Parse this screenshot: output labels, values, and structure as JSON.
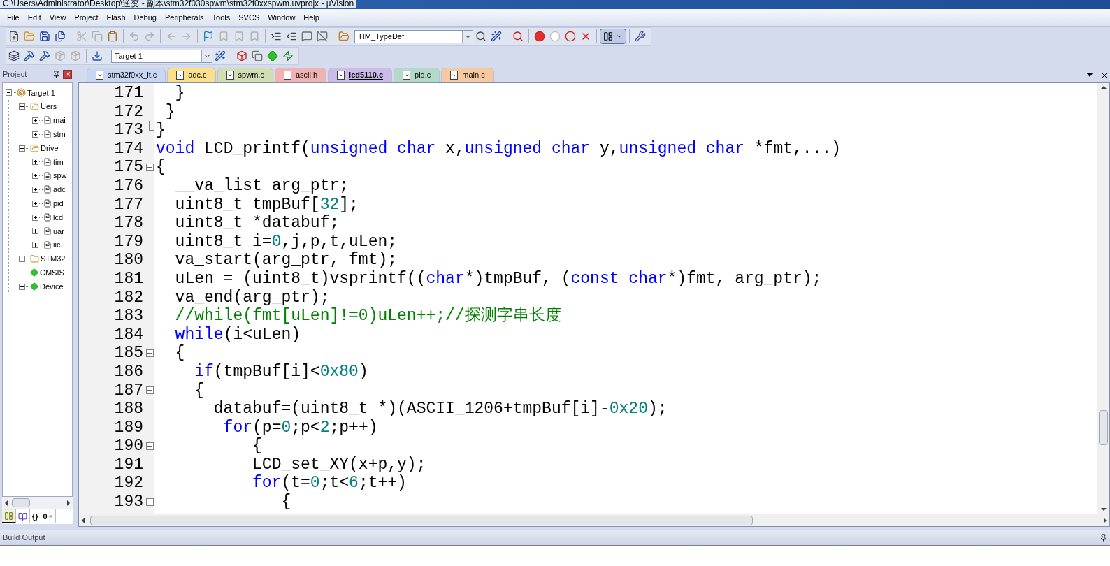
{
  "window": {
    "title": "C:\\Users\\Administrator\\Desktop\\逆变 - 副本\\stm32f030spwm\\stm32f0xxspwm.uvprojx - µVision"
  },
  "menu": [
    "File",
    "Edit",
    "View",
    "Project",
    "Flash",
    "Debug",
    "Peripherals",
    "Tools",
    "SVCS",
    "Window",
    "Help"
  ],
  "toolbar": {
    "symbol_combo": "TIM_TypeDef",
    "target_combo": "Target 1"
  },
  "project_panel": {
    "title": "Project",
    "tree": [
      {
        "label": "Target 1",
        "kind": "target",
        "expanded": true,
        "children": [
          {
            "label": "Uers",
            "kind": "folder",
            "expanded": true,
            "children": [
              {
                "label": "mai",
                "kind": "file",
                "expanded": false
              },
              {
                "label": "stm",
                "kind": "file",
                "expanded": false
              }
            ]
          },
          {
            "label": "Drive",
            "kind": "folder",
            "expanded": true,
            "children": [
              {
                "label": "tim",
                "kind": "file",
                "expanded": false
              },
              {
                "label": "spw",
                "kind": "file",
                "expanded": false
              },
              {
                "label": "adc",
                "kind": "file",
                "expanded": false
              },
              {
                "label": "pid",
                "kind": "file",
                "expanded": false
              },
              {
                "label": "lcd",
                "kind": "file",
                "expanded": false
              },
              {
                "label": "uar",
                "kind": "file",
                "expanded": false
              },
              {
                "label": "iic.",
                "kind": "file",
                "expanded": false
              }
            ]
          },
          {
            "label": "STM32",
            "kind": "folder",
            "expanded": false
          },
          {
            "label": "CMSIS",
            "kind": "component"
          },
          {
            "label": "Device",
            "kind": "component",
            "expanded": false
          }
        ]
      }
    ],
    "bottom_tabs": [
      {
        "kind": "project",
        "selected": true
      },
      {
        "kind": "books",
        "selected": false
      },
      {
        "kind": "functions",
        "label": "{}",
        "selected": false
      },
      {
        "kind": "templates",
        "label": "0",
        "selected": false
      }
    ]
  },
  "tabs": [
    {
      "label": "stm32f0xx_it.c",
      "kind": "source",
      "color": "#c9d6f2",
      "selected": false
    },
    {
      "label": "adc.c",
      "kind": "source",
      "color": "#fbe08c",
      "selected": false
    },
    {
      "label": "spwm.c",
      "kind": "source",
      "color": "#d2ddb2",
      "selected": false
    },
    {
      "label": "ascii.h",
      "kind": "header",
      "color": "#efb3b3",
      "selected": false
    },
    {
      "label": "lcd5110.c",
      "kind": "source",
      "color": "#cbbbe9",
      "selected": true
    },
    {
      "label": "pid.c",
      "kind": "source",
      "color": "#b4d9c9",
      "selected": false
    },
    {
      "label": "main.c",
      "kind": "source",
      "color": "#f7c9a1",
      "selected": false
    }
  ],
  "editor": {
    "lines": [
      {
        "number": "171",
        "fold_start": false,
        "fold_end": false,
        "tokens": [
          {
            "kind": "plain",
            "text": "  }"
          }
        ]
      },
      {
        "number": "172",
        "fold_start": false,
        "fold_end": false,
        "tokens": [
          {
            "kind": "plain",
            "text": " }"
          }
        ]
      },
      {
        "number": "173",
        "fold_start": false,
        "fold_end": true,
        "tokens": [
          {
            "kind": "plain",
            "text": "}"
          }
        ]
      },
      {
        "number": "174",
        "fold_start": false,
        "fold_end": false,
        "tokens": [
          {
            "kind": "keyword",
            "text": "void"
          },
          {
            "kind": "plain",
            "text": " LCD_printf("
          },
          {
            "kind": "keyword",
            "text": "unsigned char"
          },
          {
            "kind": "plain",
            "text": " x,"
          },
          {
            "kind": "keyword",
            "text": "unsigned char"
          },
          {
            "kind": "plain",
            "text": " y,"
          },
          {
            "kind": "keyword",
            "text": "unsigned char"
          },
          {
            "kind": "plain",
            "text": " *fmt,...)"
          }
        ]
      },
      {
        "number": "175",
        "fold_start": true,
        "fold_end": false,
        "tokens": [
          {
            "kind": "plain",
            "text": "{"
          }
        ]
      },
      {
        "number": "176",
        "fold_start": false,
        "fold_end": false,
        "tokens": [
          {
            "kind": "plain",
            "text": "  __va_list arg_ptr;"
          }
        ]
      },
      {
        "number": "177",
        "fold_start": false,
        "fold_end": false,
        "tokens": [
          {
            "kind": "plain",
            "text": "  uint8_t tmpBuf["
          },
          {
            "kind": "number",
            "text": "32"
          },
          {
            "kind": "plain",
            "text": "];"
          }
        ]
      },
      {
        "number": "178",
        "fold_start": false,
        "fold_end": false,
        "tokens": [
          {
            "kind": "plain",
            "text": "  uint8_t *databuf;"
          }
        ]
      },
      {
        "number": "179",
        "fold_start": false,
        "fold_end": false,
        "tokens": [
          {
            "kind": "plain",
            "text": "  uint8_t i="
          },
          {
            "kind": "number",
            "text": "0"
          },
          {
            "kind": "plain",
            "text": ",j,p,t,uLen;"
          }
        ]
      },
      {
        "number": "180",
        "fold_start": false,
        "fold_end": false,
        "tokens": [
          {
            "kind": "plain",
            "text": "  va_start(arg_ptr, fmt);"
          }
        ]
      },
      {
        "number": "181",
        "fold_start": false,
        "fold_end": false,
        "tokens": [
          {
            "kind": "plain",
            "text": "  uLen = (uint8_t)vsprintf(("
          },
          {
            "kind": "keyword",
            "text": "char"
          },
          {
            "kind": "plain",
            "text": "*)tmpBuf, ("
          },
          {
            "kind": "keyword",
            "text": "const char"
          },
          {
            "kind": "plain",
            "text": "*)fmt, arg_ptr);"
          }
        ]
      },
      {
        "number": "182",
        "fold_start": false,
        "fold_end": false,
        "tokens": [
          {
            "kind": "plain",
            "text": "  va_end(arg_ptr);"
          }
        ]
      },
      {
        "number": "183",
        "fold_start": false,
        "fold_end": false,
        "tokens": [
          {
            "kind": "comment",
            "text": "  //while(fmt[uLen]!=0)uLen++;//探测字串长度"
          }
        ]
      },
      {
        "number": "184",
        "fold_start": false,
        "fold_end": false,
        "tokens": [
          {
            "kind": "keyword",
            "text": "  while"
          },
          {
            "kind": "plain",
            "text": "(i<uLen)"
          }
        ]
      },
      {
        "number": "185",
        "fold_start": true,
        "fold_end": false,
        "tokens": [
          {
            "kind": "plain",
            "text": "  {"
          }
        ]
      },
      {
        "number": "186",
        "fold_start": false,
        "fold_end": false,
        "tokens": [
          {
            "kind": "keyword",
            "text": "    if"
          },
          {
            "kind": "plain",
            "text": "(tmpBuf[i]<"
          },
          {
            "kind": "number",
            "text": "0x80"
          },
          {
            "kind": "plain",
            "text": ")"
          }
        ]
      },
      {
        "number": "187",
        "fold_start": true,
        "fold_end": false,
        "tokens": [
          {
            "kind": "plain",
            "text": "    {"
          }
        ]
      },
      {
        "number": "188",
        "fold_start": false,
        "fold_end": false,
        "tokens": [
          {
            "kind": "plain",
            "text": "      databuf=(uint8_t *)(ASCII_1206+tmpBuf[i]-"
          },
          {
            "kind": "number",
            "text": "0x20"
          },
          {
            "kind": "plain",
            "text": ");"
          }
        ]
      },
      {
        "number": "189",
        "fold_start": false,
        "fold_end": false,
        "tokens": [
          {
            "kind": "keyword",
            "text": "       for"
          },
          {
            "kind": "plain",
            "text": "(p="
          },
          {
            "kind": "number",
            "text": "0"
          },
          {
            "kind": "plain",
            "text": ";p<"
          },
          {
            "kind": "number",
            "text": "2"
          },
          {
            "kind": "plain",
            "text": ";p++)"
          }
        ]
      },
      {
        "number": "190",
        "fold_start": true,
        "fold_end": false,
        "tokens": [
          {
            "kind": "plain",
            "text": "          {"
          }
        ]
      },
      {
        "number": "191",
        "fold_start": false,
        "fold_end": false,
        "tokens": [
          {
            "kind": "plain",
            "text": "          LCD_set_XY(x+p,y);"
          }
        ]
      },
      {
        "number": "192",
        "fold_start": false,
        "fold_end": false,
        "tokens": [
          {
            "kind": "keyword",
            "text": "          for"
          },
          {
            "kind": "plain",
            "text": "(t="
          },
          {
            "kind": "number",
            "text": "0"
          },
          {
            "kind": "plain",
            "text": ";t<"
          },
          {
            "kind": "number",
            "text": "6"
          },
          {
            "kind": "plain",
            "text": ";t++)"
          }
        ]
      },
      {
        "number": "193",
        "fold_start": true,
        "fold_end": false,
        "tokens": [
          {
            "kind": "plain",
            "text": "             {"
          }
        ]
      }
    ]
  },
  "output_panel": {
    "title": "Build Output"
  }
}
